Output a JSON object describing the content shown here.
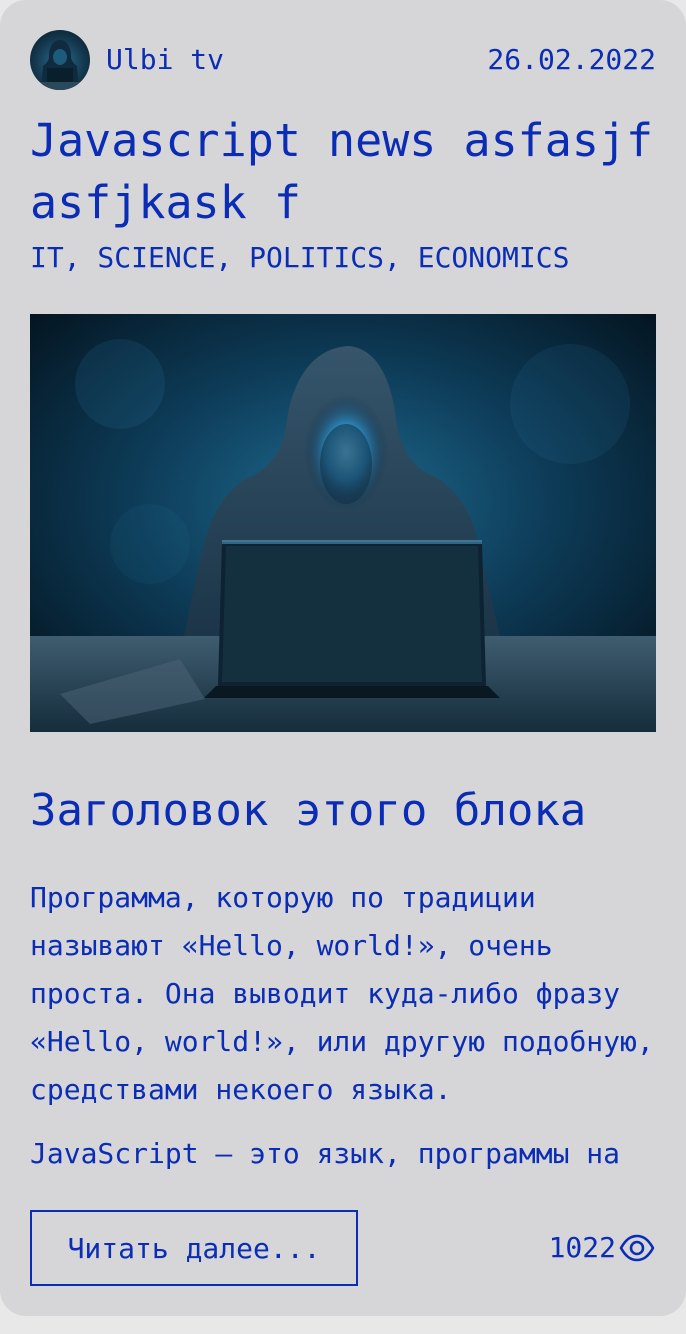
{
  "post": {
    "author": "Ulbi tv",
    "date": "26.02.2022",
    "title": "Javascript news asfasjf asfjkask f",
    "tags": "IT, SCIENCE, POLITICS, ECONOMICS",
    "block_title": "Заголовок этого блока",
    "paragraphs": [
      "Программа, которую по традиции называют «Hello, world!», очень проста. Она выводит куда-либо фразу «Hello, world!», или другую подобную, средствами некоего языка.",
      "JavaScript — это язык, программы на"
    ],
    "read_more_label": "Читать далее...",
    "views": "1022"
  },
  "icons": {
    "views": "eye-icon"
  },
  "colors": {
    "accent": "#0b2db5",
    "card_background": "#d6d6d9",
    "page_background": "#e8e8e8"
  }
}
